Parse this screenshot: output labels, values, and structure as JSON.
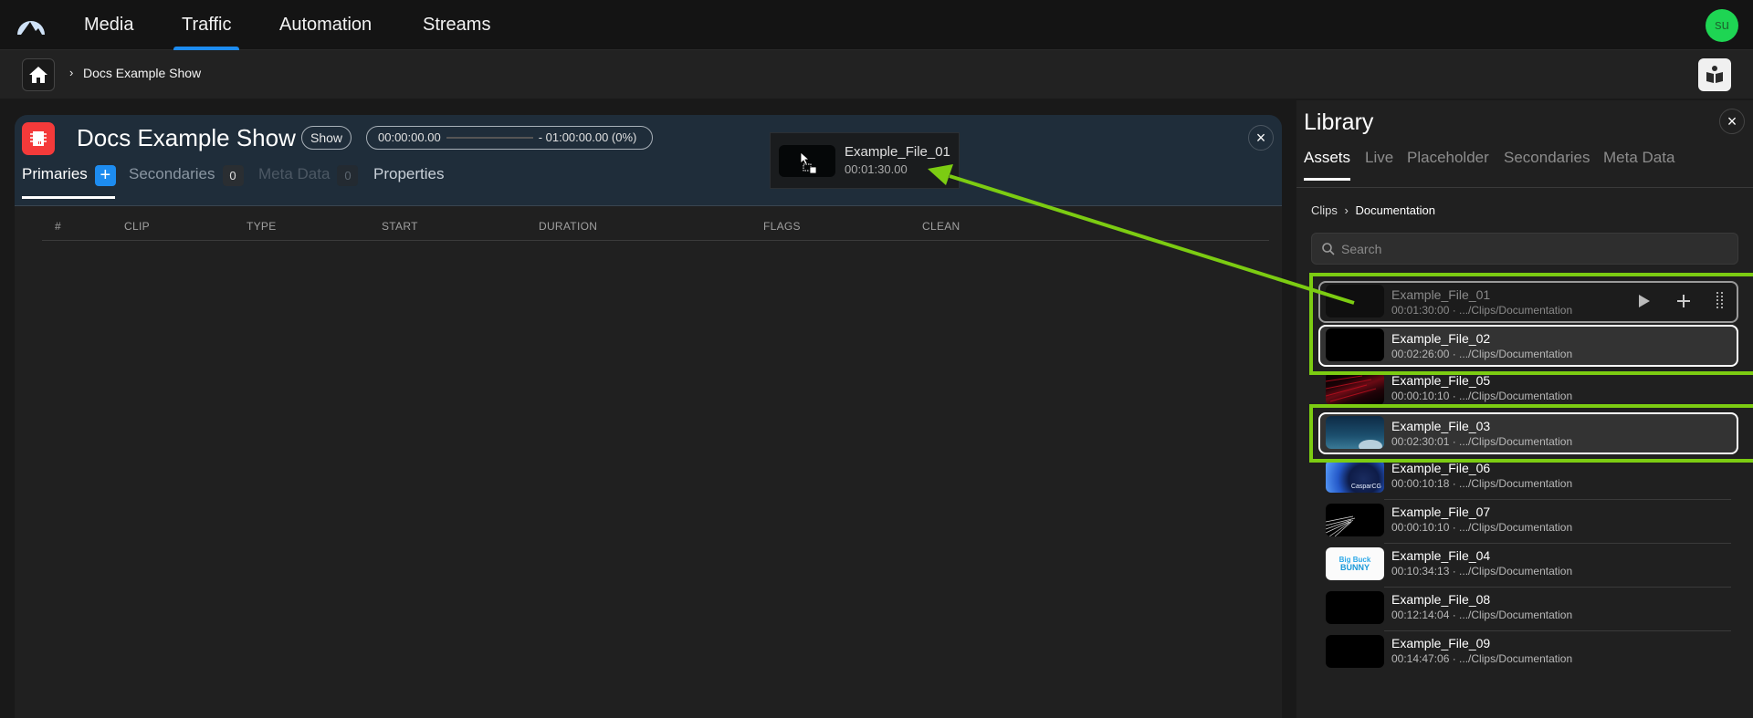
{
  "nav": {
    "logo": "mountain-logo",
    "items": [
      {
        "label": "Media",
        "active": false
      },
      {
        "label": "Traffic",
        "active": true
      },
      {
        "label": "Automation",
        "active": false
      },
      {
        "label": "Streams",
        "active": false
      }
    ],
    "avatar_initials": "su",
    "avatar_color": "#1ed553"
  },
  "breadcrumb": {
    "home_icon": "home-icon",
    "separator": "›",
    "current": "Docs Example Show",
    "help_icon": "book-reader-icon"
  },
  "show": {
    "title": "Docs Example Show",
    "badge": "Show",
    "timeline": {
      "start": "00:00:00.00",
      "end": "- 01:00:00.00 (0%)",
      "progress_percent": 0
    },
    "close_icon": "×",
    "tabs": [
      {
        "label": "Primaries",
        "state": "active",
        "badge": "+"
      },
      {
        "label": "Secondaries",
        "state": "inactive",
        "badge": "0"
      },
      {
        "label": "Meta Data",
        "state": "disabled",
        "badge": "0"
      },
      {
        "label": "Properties",
        "state": "inactive",
        "badge": null
      }
    ],
    "columns": [
      "#",
      "CLIP",
      "TYPE",
      "START",
      "DURATION",
      "FLAGS",
      "CLEAN"
    ],
    "rows": []
  },
  "drag_ghost": {
    "name": "Example_File_01",
    "duration": "00:01:30.00"
  },
  "library": {
    "title": "Library",
    "close_icon": "×",
    "tabs": [
      {
        "label": "Assets",
        "active": true
      },
      {
        "label": "Live",
        "active": false
      },
      {
        "label": "Placeholder",
        "active": false
      },
      {
        "label": "Secondaries",
        "active": false
      },
      {
        "label": "Meta Data",
        "active": false
      }
    ],
    "path": {
      "root": "Clips",
      "separator": "›",
      "current": "Documentation"
    },
    "search_placeholder": "Search",
    "assets": [
      {
        "name": "Example_File_01",
        "meta": "00:01:30:00 · .../Clips/Documentation",
        "state": "hover",
        "thumb": "black"
      },
      {
        "name": "Example_File_02",
        "meta": "00:02:26:00 · .../Clips/Documentation",
        "state": "selected",
        "thumb": "black"
      },
      {
        "name": "Example_File_05",
        "meta": "00:00:10:10 · .../Clips/Documentation",
        "state": "normal",
        "thumb": "red-lines"
      },
      {
        "name": "Example_File_03",
        "meta": "00:02:30:01 · .../Clips/Documentation",
        "state": "selected",
        "thumb": "sky"
      },
      {
        "name": "Example_File_06",
        "meta": "00:00:10:18 · .../Clips/Documentation",
        "state": "normal",
        "thumb": "globe"
      },
      {
        "name": "Example_File_07",
        "meta": "00:00:10:10 · .../Clips/Documentation",
        "state": "normal",
        "thumb": "white-lines"
      },
      {
        "name": "Example_File_04",
        "meta": "00:10:34:13 · .../Clips/Documentation",
        "state": "normal",
        "thumb": "big-buck-bunny"
      },
      {
        "name": "Example_File_08",
        "meta": "00:12:14:04 · .../Clips/Documentation",
        "state": "normal",
        "thumb": "black"
      },
      {
        "name": "Example_File_09",
        "meta": "00:14:47:06 · .../Clips/Documentation",
        "state": "normal",
        "thumb": "black"
      }
    ],
    "row_actions": [
      "play-icon",
      "add-icon",
      "drag-handle-icon"
    ],
    "thumb_texts": {
      "globe": "CasparCG",
      "bunny_line1": "Big Buck",
      "bunny_line2": "BUNNY"
    }
  },
  "annotation_color": "#7ccc12"
}
